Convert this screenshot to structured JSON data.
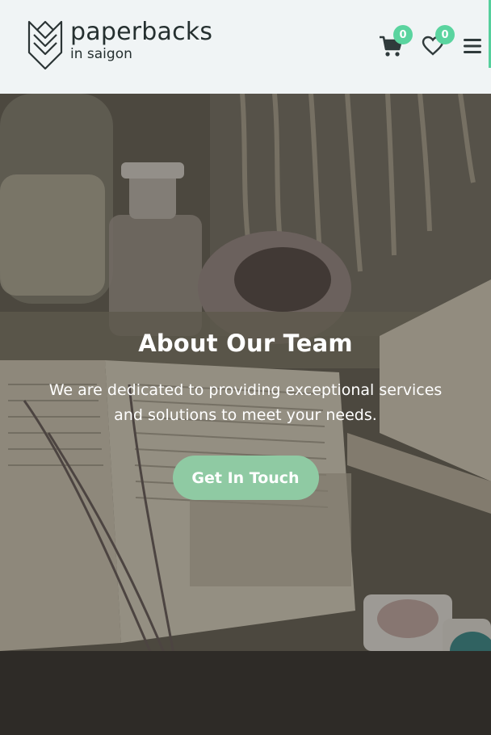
{
  "brand": {
    "name": "paperbacks",
    "tagline": "in saigon"
  },
  "header": {
    "cart_count": "0",
    "wishlist_count": "0",
    "icons": [
      "cart-icon",
      "heart-icon",
      "menu-icon"
    ]
  },
  "hero": {
    "title": "About Our Team",
    "description": "We are dedicated to providing exceptional services and solutions to meet your needs.",
    "cta_label": "Get In Touch"
  },
  "colors": {
    "accent": "#5ad49f",
    "cta": "#8fcaa3",
    "header_bg": "#f0f4f5"
  }
}
